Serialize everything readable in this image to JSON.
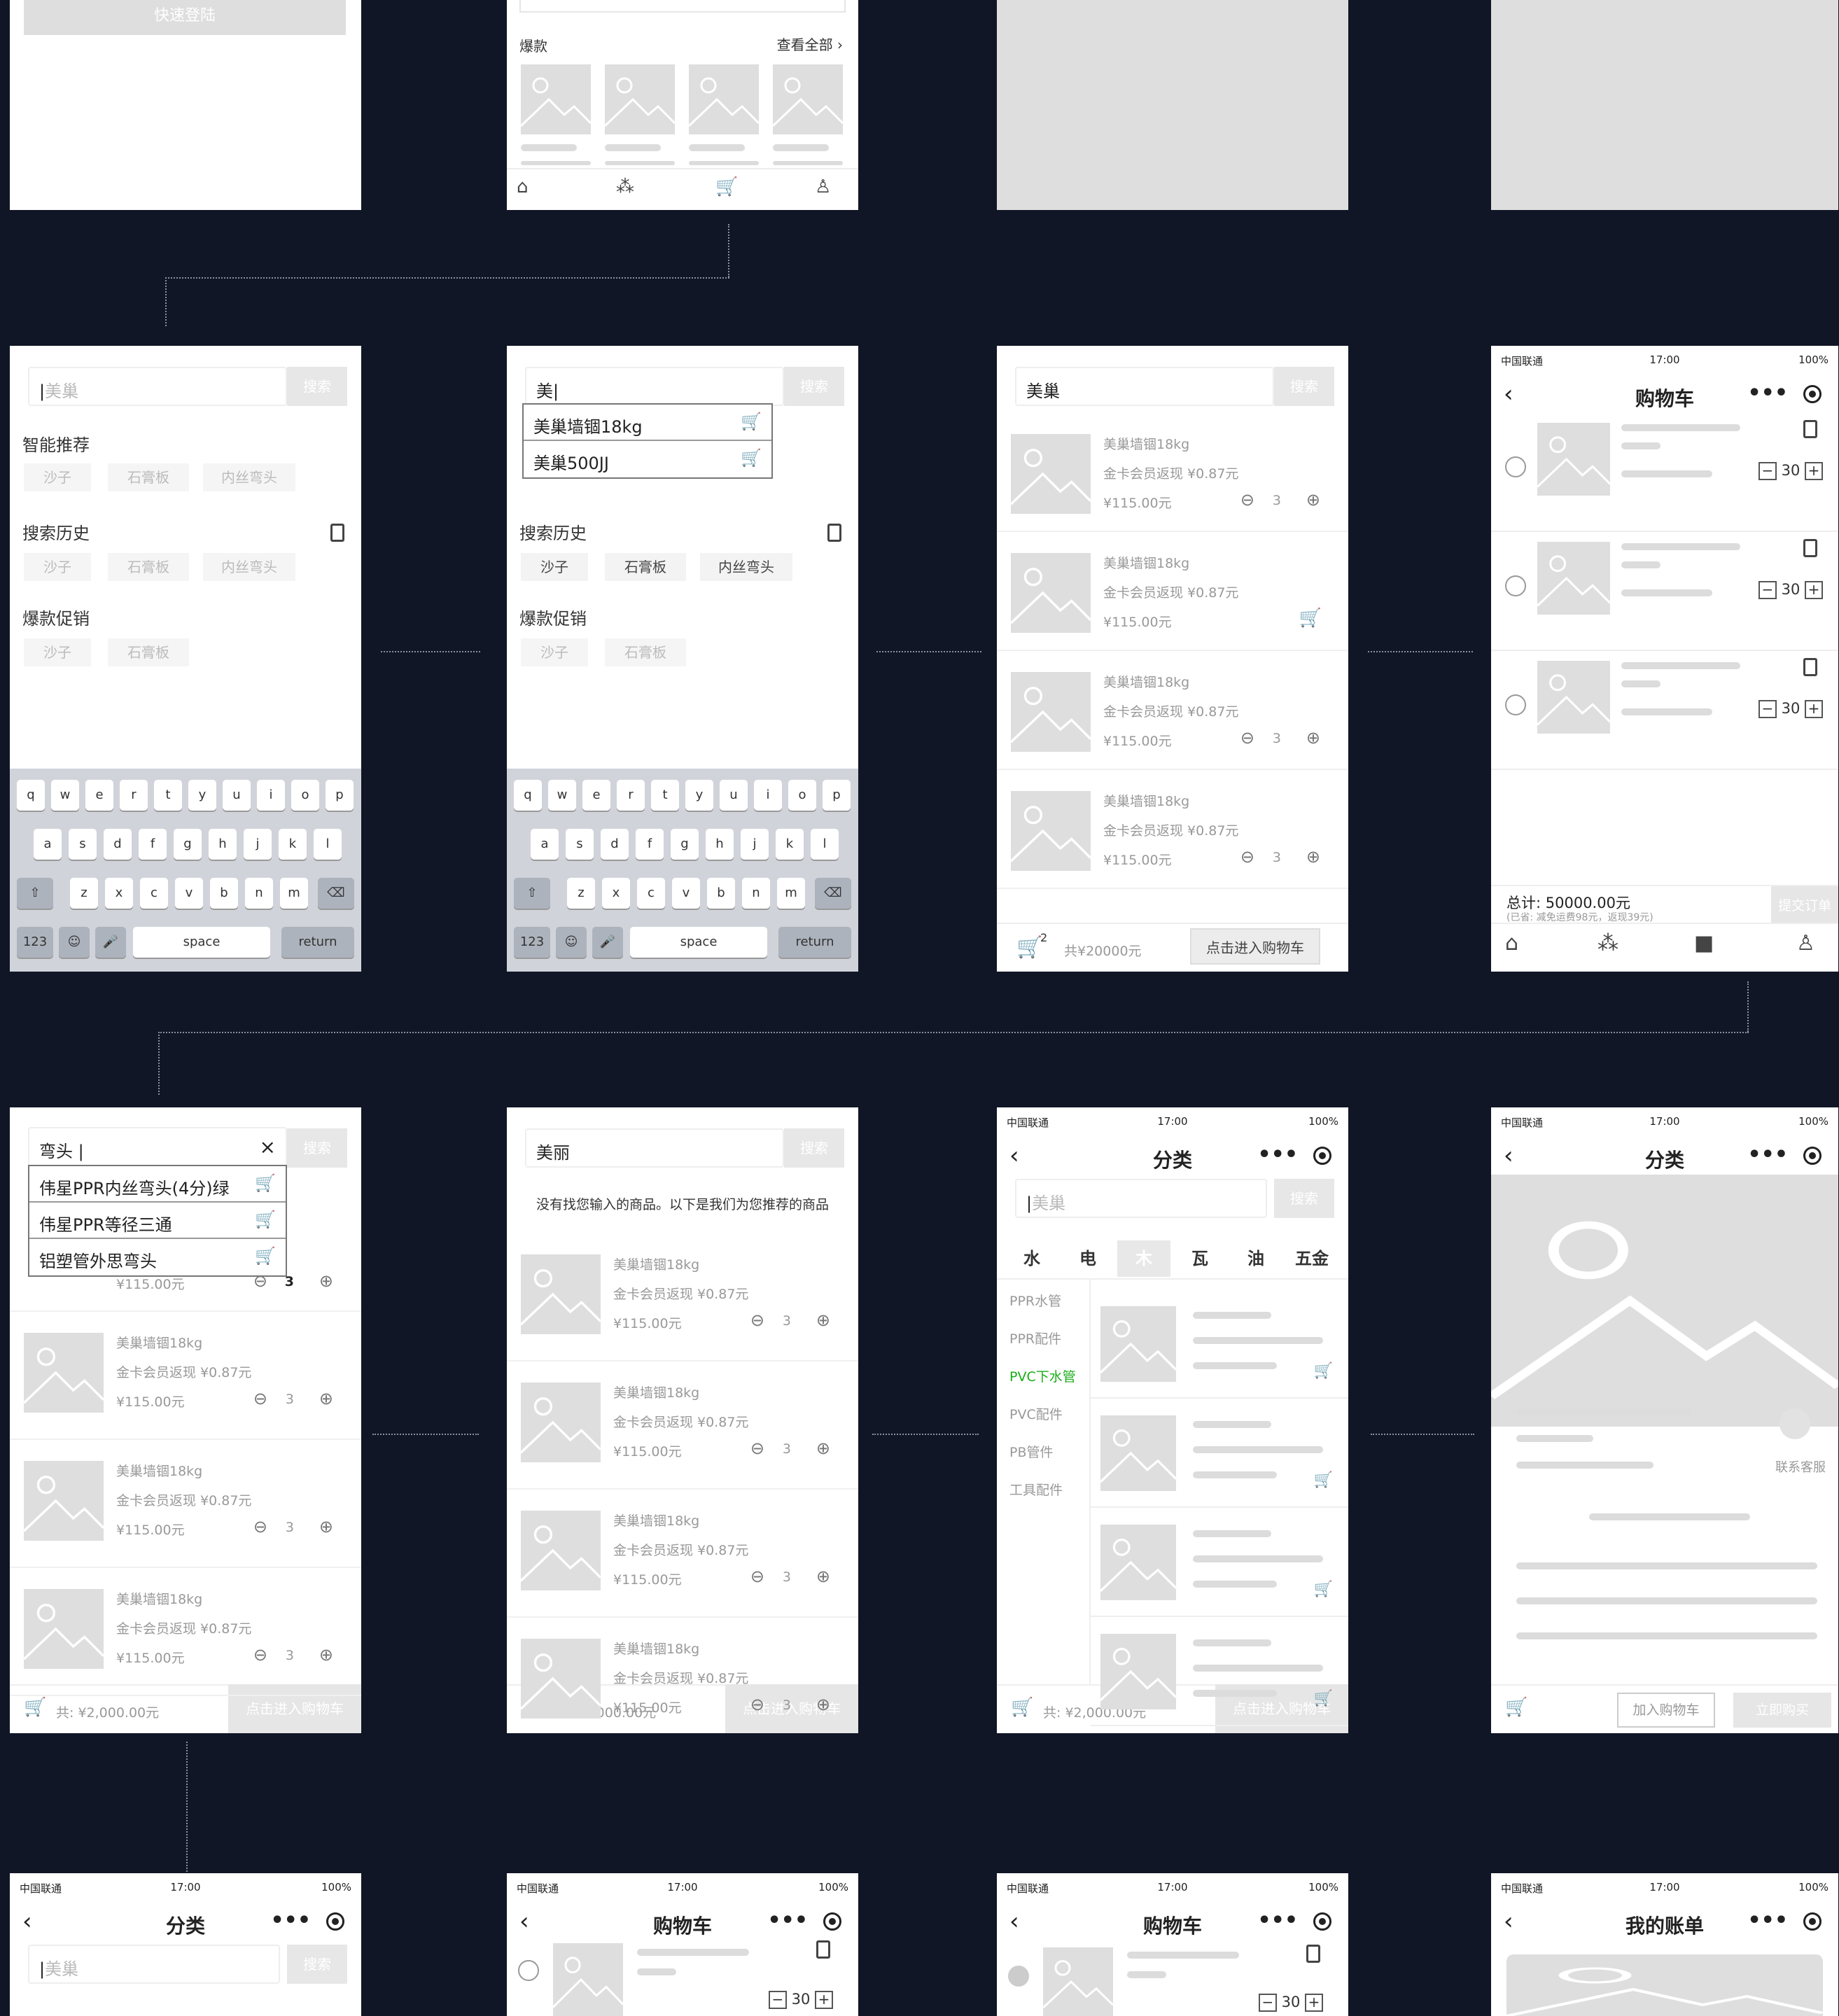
{
  "colors": {
    "bg": "#111626",
    "accent": "#1aad19",
    "placeholder": "#dedede"
  },
  "status": {
    "carrier": "中国联通",
    "time": "17:00",
    "battery": "100%"
  },
  "s1": {
    "button": "快速登陆"
  },
  "s2": {
    "section": "爆款",
    "view_all": "查看全部"
  },
  "s5": {
    "query": "美巢",
    "search": "搜索",
    "smart": "智能推荐",
    "history": "搜索历史",
    "promo": "爆款促销",
    "tags_smart": [
      "沙子",
      "石膏板",
      "内丝弯头"
    ],
    "tags_history": [
      "沙子",
      "石膏板",
      "内丝弯头"
    ],
    "tags_promo": [
      "沙子",
      "石膏板"
    ]
  },
  "s6": {
    "query": "美",
    "suggest": [
      "美巢墙锢18kg",
      "美巢500JJ"
    ]
  },
  "keyboard": {
    "row1": [
      "q",
      "w",
      "e",
      "r",
      "t",
      "y",
      "u",
      "i",
      "o",
      "p"
    ],
    "row2": [
      "a",
      "s",
      "d",
      "f",
      "g",
      "h",
      "j",
      "k",
      "l"
    ],
    "row3": [
      "z",
      "x",
      "c",
      "v",
      "b",
      "n",
      "m"
    ],
    "num": "123",
    "space": "space",
    "ret": "return"
  },
  "product": {
    "name": "美巢墙锢18kg",
    "rebate": "金卡会员返现 ¥0.87元",
    "price": "¥115.00元",
    "qty": "3"
  },
  "s7": {
    "query": "美巢",
    "total": "共¥20000元",
    "enter": "点击进入购物车",
    "badge": "2"
  },
  "cart": {
    "title": "购物车",
    "qty": "30",
    "total": "总计: 50000.00元",
    "note": "(已省: 减免运费98元，返现39元)",
    "submit": "提交订单"
  },
  "s9": {
    "query": "弯头",
    "suggest": [
      "伟星PPR内丝弯头(4分)绿",
      "伟星PPR等径三通",
      "铝塑管外思弯头"
    ],
    "price_cut": "¥115.00元"
  },
  "s10": {
    "query": "美丽",
    "notice": "没有找您输入的商品。以下是我们为您推荐的商品"
  },
  "footer": {
    "total": "共: ¥2,000.00元",
    "enter": "点击进入购物车"
  },
  "cat": {
    "title": "分类",
    "placeholder": "美巢",
    "search": "搜索",
    "tabs": [
      "水",
      "电",
      "木",
      "瓦",
      "油",
      "五金"
    ],
    "side": [
      "PPR水管",
      "PPR配件",
      "PVC下水管",
      "PVC配件",
      "PB管件",
      "工具配件"
    ]
  },
  "detail": {
    "service": "联系客服",
    "add": "加入购物车",
    "buy": "立即购买"
  },
  "bill": {
    "title": "我的账单"
  }
}
